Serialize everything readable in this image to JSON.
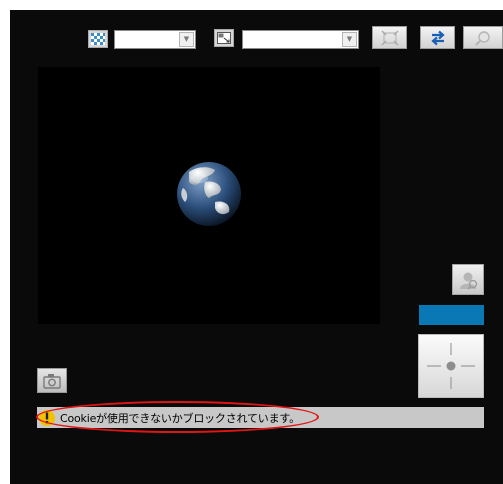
{
  "toolbar": {
    "quality_icon": "checkerboard-quality-icon",
    "quality_select_value": "",
    "size_icon": "resize-window-icon",
    "size_select_value": "",
    "fullscreen_icon": "fullscreen-icon",
    "swap_icon": "swap-arrows-icon",
    "zoom_icon": "magnifier-icon",
    "accent_color": "#1a5fb4"
  },
  "video": {
    "background_color": "#000000",
    "placeholder_icon": "globe-icon"
  },
  "controls": {
    "snapshot_icon": "camera-icon",
    "person_icon": "person-icon",
    "level_bar_color": "#0a78b4",
    "ptz_icon": "crosshair-joystick-icon"
  },
  "status": {
    "icon": "warning-icon",
    "message": "Cookieが使用できないかブロックされています。",
    "highlight_color": "#e01515"
  }
}
